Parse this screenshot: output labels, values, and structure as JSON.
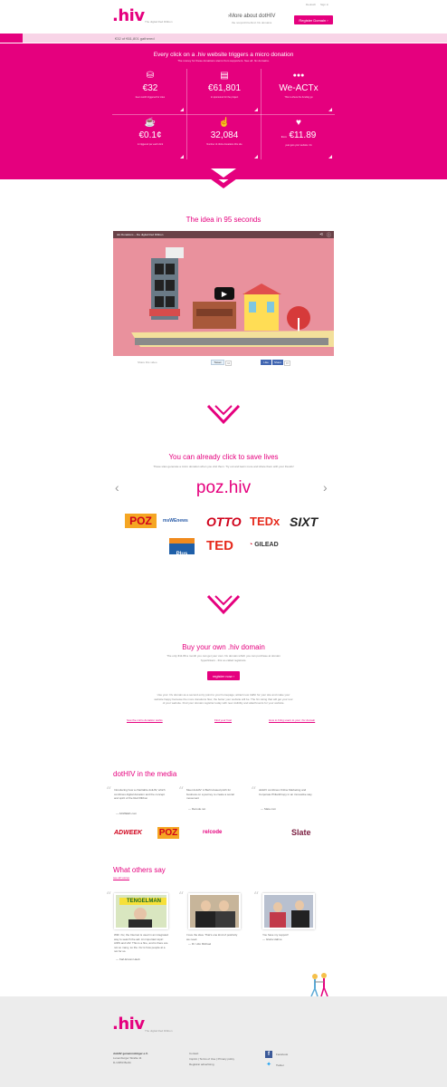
{
  "header": {
    "logo": ".hiv",
    "tagline": "The digital Red Ribbon",
    "more_label": "More about dotHIV",
    "more_sub": "the nonprofit behind .hiv domains",
    "register_label": "Register Domain",
    "lang": [
      "Deutsch",
      "Sign in"
    ]
  },
  "progress": {
    "text": "€32 of €61,801 gathered",
    "fraction": 0.05
  },
  "hero": {
    "title": "Every click on a .hiv website triggers a micro donation",
    "subtitle": "The money for these donations stems from supporters. See all .hiv domains.",
    "stats": [
      {
        "icon": "coins-icon",
        "glyph": "⛁",
        "value": "€32",
        "label": "been worth triggered for sites"
      },
      {
        "icon": "money-icon",
        "glyph": "▤",
        "value": "€61,801",
        "label": "in sponsored for the project"
      },
      {
        "icon": "people-icon",
        "glyph": "●●●",
        "value": "We-ACTx",
        "label": "This is where the funding go"
      },
      {
        "icon": "cup-icon",
        "glyph": "☕",
        "value": "€0.1¢",
        "label": "is triggered per each click"
      },
      {
        "icon": "click-icon",
        "glyph": "☝",
        "value": "32,084",
        "label": "Number of clicks donations this site"
      },
      {
        "icon": "heart-icon",
        "glyph": "♥",
        "value": "€11.89",
        "label": "year gets your website .hiv"
      }
    ],
    "value_prefix": "from"
  },
  "video": {
    "section_title": "The idea in 95 seconds",
    "title": "dot Donations – the digital Red Ribbon",
    "share_label": "Share this video",
    "tweet_label": "Tweet",
    "tweet_count": "94",
    "like_label": "Like",
    "share_btn": "Share",
    "like_count": "87"
  },
  "click": {
    "title": "You can already click to save lives",
    "subtitle": "These sites generate a micro donation when you visit them. Try out and learn more and share them with your friends!",
    "current_domain": "poz.hiv",
    "logos": [
      "POZ",
      "msWEnews",
      "OTTO",
      "TEDx",
      "SIXT",
      "Plus",
      "TED",
      "GILEAD"
    ]
  },
  "buy": {
    "title": "Buy your own .hiv domain",
    "text": "The only €11.89 a month you can get your own .hiv domain which you can purchase at domain hyperlinkers - this so-called registrars.",
    "button": "register now",
    "text2": "Use your .hiv domain as a second entry point to your homepage; attract new traffic for your site and make your website happy because the more donations flow, the better your website will be. The hiv rating that will get your tour of your website. Find your domain registrar today with new visibility and attachments for your website.",
    "links": [
      "how the micro donation works",
      "Find your host",
      "How to bring users to your .hiv domain"
    ]
  },
  "media": {
    "title": "dotHIV in the media",
    "quotes": [
      {
        "text": "Introducing how a charitable dotHIV, which combines digital donation and the concept and spirit of the Red Ribbon",
        "source": "— ADWEEK.com"
      },
      {
        "text": "Meet dotHIV: A Berlin-based pitch for business on a journey to create a social movement",
        "source": "— Recode.net"
      },
      {
        "text": "dotHIV combines Online Marketing and Corporate Philanthropy in an innovative way",
        "source": "— Slate.com"
      }
    ],
    "logos": [
      "ADWEEK",
      "POZ",
      "re/code",
      "Slate"
    ]
  },
  "testimonials": {
    "title": "What others say",
    "link": "see all voices",
    "items": [
      {
        "text": "With .hiv, the Internet is used in an integrated way to search the aid. An important topic: AIDS and HIV. This is a fine, and is there are not so many, so the .hiv is how people at a not for us.",
        "source": "— Karl-Erivan Haub",
        "sign": "TENGELMAN"
      },
      {
        "text": "I love the idea. That's one kind of positivity we need.",
        "source": "— Dr. Udo Michael"
      },
      {
        "text": "You have my support!",
        "source": "— Gloria Hahne"
      }
    ]
  },
  "footer": {
    "logo": ".hiv",
    "tagline": "The digital Red Ribbon",
    "org": [
      "dotHIV gemeinnütziger e.V.",
      "Luxemburger Straße 11",
      "D-13353 Berlin"
    ],
    "links": [
      "Contact",
      "Imprint | Terms of Use | Privacy policy",
      "Registrar advertising"
    ],
    "social": [
      "Facebook",
      "Twitter"
    ]
  },
  "colors": {
    "accent": "#e5007e",
    "progress_bg": "#f8d4e7",
    "footer_bg": "#ececec"
  }
}
